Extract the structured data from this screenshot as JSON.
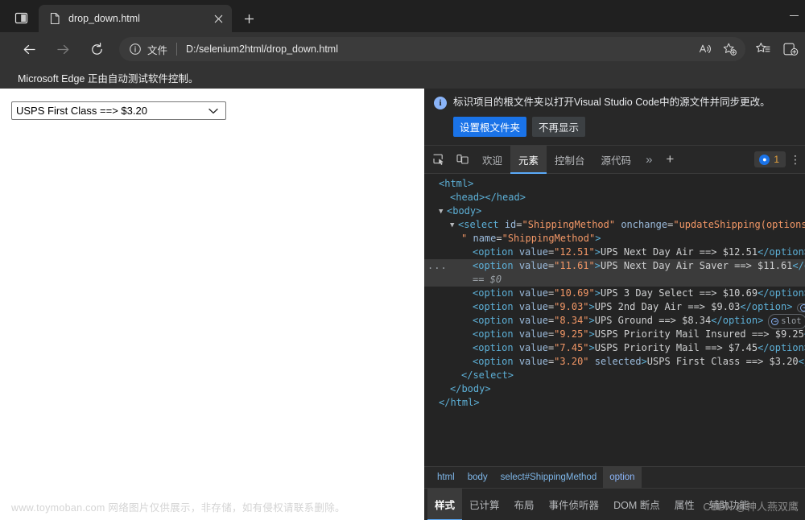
{
  "browser": {
    "tab_actions_icon": "split-screen-icon",
    "tab": {
      "favicon": "document-icon",
      "title": "drop_down.html",
      "close_icon": "close-icon"
    },
    "new_tab_icon": "plus-icon",
    "window_controls": {
      "minimize": "minimize-icon"
    },
    "toolbar": {
      "back_icon": "arrow-left-icon",
      "forward_icon": "arrow-right-icon",
      "reload_icon": "reload-icon",
      "address": {
        "info_icon": "info-circle-icon",
        "scheme_label": "文件",
        "url": "D:/selenium2html/drop_down.html",
        "read_aloud_icon": "read-aloud-icon",
        "add_favorite_icon": "star-plus-icon"
      },
      "favorites_icon": "star-list-icon",
      "collections_icon": "collections-icon"
    },
    "automation_notice": "Microsoft Edge 正由自动测试软件控制。"
  },
  "page": {
    "select": {
      "selected_label": "USPS First Class ==> $3.20",
      "caret_icon": "chevron-down-icon"
    },
    "watermark": "www.toymoban.com 网络图片仅供展示，非存储，如有侵权请联系删除。"
  },
  "devtools": {
    "infobar": {
      "icon": "info-icon",
      "icon_glyph": "i",
      "message": "标识项目的根文件夹以打开Visual Studio Code中的源文件并同步更改。",
      "primary_button": "设置根文件夹",
      "secondary_button": "不再显示"
    },
    "toolbar_icons": [
      {
        "name": "inspect-element-icon"
      },
      {
        "name": "device-toolbar-icon"
      }
    ],
    "tabs": [
      {
        "label": "欢迎",
        "active": false,
        "name": "tab-welcome"
      },
      {
        "label": "元素",
        "active": true,
        "name": "tab-elements"
      },
      {
        "label": "控制台",
        "active": false,
        "name": "tab-console"
      },
      {
        "label": "源代码",
        "active": false,
        "name": "tab-sources"
      }
    ],
    "tabs_overflow": "»",
    "tabs_add": "+",
    "message_badge": {
      "icon": "message-icon",
      "count": "1"
    },
    "kebab": "⋮",
    "tree": [
      {
        "indent": 1,
        "twisty": "",
        "highlight": false,
        "dots": false,
        "tokens": [
          {
            "t": "tag",
            "v": "<html>"
          }
        ]
      },
      {
        "indent": 2,
        "twisty": "",
        "highlight": false,
        "dots": false,
        "tokens": [
          {
            "t": "tag",
            "v": "<head></head>"
          }
        ]
      },
      {
        "indent": 1,
        "twisty": "▼",
        "highlight": false,
        "dots": false,
        "tokens": [
          {
            "t": "tag",
            "v": "<body>"
          }
        ]
      },
      {
        "indent": 2,
        "twisty": "▼",
        "highlight": false,
        "dots": false,
        "tokens": [
          {
            "t": "tag",
            "v": "<select"
          },
          {
            "t": "plain",
            "v": " "
          },
          {
            "t": "attr",
            "v": "id"
          },
          {
            "t": "plain",
            "v": "="
          },
          {
            "t": "val",
            "v": "\"ShippingMethod\""
          },
          {
            "t": "plain",
            "v": " "
          },
          {
            "t": "attr",
            "v": "onchange"
          },
          {
            "t": "plain",
            "v": "="
          },
          {
            "t": "val",
            "v": "\"updateShipping(options"
          }
        ]
      },
      {
        "indent": 3,
        "twisty": "",
        "highlight": false,
        "dots": false,
        "tokens": [
          {
            "t": "val",
            "v": "\""
          },
          {
            "t": "plain",
            "v": " "
          },
          {
            "t": "attr",
            "v": "name"
          },
          {
            "t": "plain",
            "v": "="
          },
          {
            "t": "val",
            "v": "\"ShippingMethod\""
          },
          {
            "t": "tag",
            "v": ">"
          }
        ]
      },
      {
        "indent": 4,
        "twisty": "",
        "highlight": false,
        "dots": false,
        "tokens": [
          {
            "t": "tag",
            "v": "<option"
          },
          {
            "t": "plain",
            "v": " "
          },
          {
            "t": "attr",
            "v": "value"
          },
          {
            "t": "plain",
            "v": "="
          },
          {
            "t": "val",
            "v": "\"12.51\""
          },
          {
            "t": "tag",
            "v": ">"
          },
          {
            "t": "text",
            "v": "UPS Next Day Air ==> $12.51"
          },
          {
            "t": "tag",
            "v": "</option>"
          }
        ]
      },
      {
        "indent": 4,
        "twisty": "",
        "highlight": true,
        "dots": true,
        "tokens": [
          {
            "t": "tag",
            "v": "<option"
          },
          {
            "t": "plain",
            "v": " "
          },
          {
            "t": "attr",
            "v": "value"
          },
          {
            "t": "plain",
            "v": "="
          },
          {
            "t": "val",
            "v": "\"11.61\""
          },
          {
            "t": "tag",
            "v": ">"
          },
          {
            "t": "text",
            "v": "UPS Next Day Air Saver ==> $11.61"
          },
          {
            "t": "tag",
            "v": "</o"
          }
        ]
      },
      {
        "indent": 4,
        "twisty": "",
        "highlight": true,
        "dots": false,
        "subline": true,
        "text": "== $0"
      },
      {
        "indent": 4,
        "twisty": "",
        "highlight": false,
        "dots": false,
        "tokens": [
          {
            "t": "tag",
            "v": "<option"
          },
          {
            "t": "plain",
            "v": " "
          },
          {
            "t": "attr",
            "v": "value"
          },
          {
            "t": "plain",
            "v": "="
          },
          {
            "t": "val",
            "v": "\"10.69\""
          },
          {
            "t": "tag",
            "v": ">"
          },
          {
            "t": "text",
            "v": "UPS 3 Day Select ==> $10.69"
          },
          {
            "t": "tag",
            "v": "</option>"
          }
        ]
      },
      {
        "indent": 4,
        "twisty": "",
        "highlight": false,
        "dots": false,
        "slot": true,
        "tokens": [
          {
            "t": "tag",
            "v": "<option"
          },
          {
            "t": "plain",
            "v": " "
          },
          {
            "t": "attr",
            "v": "value"
          },
          {
            "t": "plain",
            "v": "="
          },
          {
            "t": "val",
            "v": "\"9.03\""
          },
          {
            "t": "tag",
            "v": ">"
          },
          {
            "t": "text",
            "v": "UPS 2nd Day Air ==> $9.03"
          },
          {
            "t": "tag",
            "v": "</option>"
          }
        ]
      },
      {
        "indent": 4,
        "twisty": "",
        "highlight": false,
        "dots": false,
        "slot": true,
        "slot_label": "slot",
        "tokens": [
          {
            "t": "tag",
            "v": "<option"
          },
          {
            "t": "plain",
            "v": " "
          },
          {
            "t": "attr",
            "v": "value"
          },
          {
            "t": "plain",
            "v": "="
          },
          {
            "t": "val",
            "v": "\"8.34\""
          },
          {
            "t": "tag",
            "v": ">"
          },
          {
            "t": "text",
            "v": "UPS Ground ==> $8.34"
          },
          {
            "t": "tag",
            "v": "</option>"
          }
        ]
      },
      {
        "indent": 4,
        "twisty": "",
        "highlight": false,
        "dots": false,
        "tokens": [
          {
            "t": "tag",
            "v": "<option"
          },
          {
            "t": "plain",
            "v": " "
          },
          {
            "t": "attr",
            "v": "value"
          },
          {
            "t": "plain",
            "v": "="
          },
          {
            "t": "val",
            "v": "\"9.25\""
          },
          {
            "t": "tag",
            "v": ">"
          },
          {
            "t": "text",
            "v": "USPS Priority Mail Insured ==> $9.25"
          },
          {
            "t": "tag",
            "v": "<"
          }
        ]
      },
      {
        "indent": 4,
        "twisty": "",
        "highlight": false,
        "dots": false,
        "tokens": [
          {
            "t": "tag",
            "v": "<option"
          },
          {
            "t": "plain",
            "v": " "
          },
          {
            "t": "attr",
            "v": "value"
          },
          {
            "t": "plain",
            "v": "="
          },
          {
            "t": "val",
            "v": "\"7.45\""
          },
          {
            "t": "tag",
            "v": ">"
          },
          {
            "t": "text",
            "v": "USPS Priority Mail ==> $7.45"
          },
          {
            "t": "tag",
            "v": "</option>"
          }
        ]
      },
      {
        "indent": 4,
        "twisty": "",
        "highlight": false,
        "dots": false,
        "tokens": [
          {
            "t": "tag",
            "v": "<option"
          },
          {
            "t": "plain",
            "v": " "
          },
          {
            "t": "attr",
            "v": "value"
          },
          {
            "t": "plain",
            "v": "="
          },
          {
            "t": "val",
            "v": "\"3.20\""
          },
          {
            "t": "plain",
            "v": " "
          },
          {
            "t": "attr",
            "v": "selected"
          },
          {
            "t": "tag",
            "v": ">"
          },
          {
            "t": "text",
            "v": "USPS First Class ==> $3.20"
          },
          {
            "t": "tag",
            "v": "</"
          }
        ]
      },
      {
        "indent": 3,
        "twisty": "",
        "highlight": false,
        "dots": false,
        "tokens": [
          {
            "t": "tag",
            "v": "</select>"
          }
        ]
      },
      {
        "indent": 2,
        "twisty": "",
        "highlight": false,
        "dots": false,
        "tokens": [
          {
            "t": "tag",
            "v": "</body>"
          }
        ]
      },
      {
        "indent": 1,
        "twisty": "",
        "highlight": false,
        "dots": false,
        "tokens": [
          {
            "t": "tag",
            "v": "</html>"
          }
        ]
      }
    ],
    "breadcrumb": [
      {
        "label": "html",
        "active": false
      },
      {
        "label": "body",
        "active": false
      },
      {
        "label": "select#ShippingMethod",
        "active": false
      },
      {
        "label": "option",
        "active": true
      }
    ],
    "sidebar_tabs": [
      {
        "label": "样式",
        "active": true
      },
      {
        "label": "已计算",
        "active": false
      },
      {
        "label": "布局",
        "active": false
      },
      {
        "label": "事件侦听器",
        "active": false
      },
      {
        "label": "DOM 断点",
        "active": false
      },
      {
        "label": "属性",
        "active": false
      },
      {
        "label": "辅助功能",
        "active": false
      }
    ],
    "watermark": "CSDN @神人燕双鹰"
  },
  "colors": {
    "chrome_bg": "#333333",
    "tabstrip_bg": "#202020",
    "devtools_bg": "#242424",
    "devtools_panel_bg": "#282828",
    "accent_blue": "#1a73e8",
    "tab_underline": "#5aa9f8",
    "tag_color": "#5db0d7",
    "attr_color": "#9bbbdc",
    "value_color": "#f29766"
  }
}
